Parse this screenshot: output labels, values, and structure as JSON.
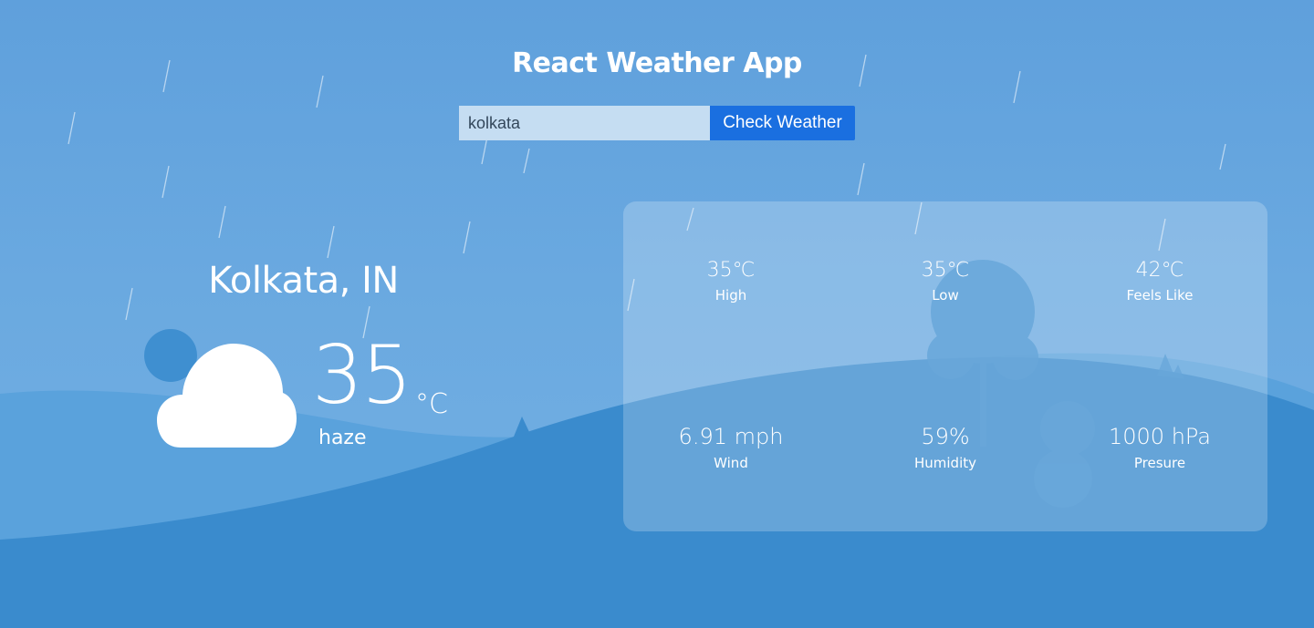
{
  "app": {
    "title": "React Weather App"
  },
  "search": {
    "value": "kolkata",
    "button_label": "Check Weather"
  },
  "current": {
    "city": "Kolkata, IN",
    "temp": "35",
    "unit": "°C",
    "description": "haze",
    "icon": "cloud-icon"
  },
  "details": {
    "high": {
      "value": "35℃",
      "label": "High"
    },
    "low": {
      "value": "35℃",
      "label": "Low"
    },
    "feels_like": {
      "value": "42℃",
      "label": "Feels Like"
    },
    "wind": {
      "value": "6.91 mph",
      "label": "Wind"
    },
    "humidity": {
      "value": "59%",
      "label": "Humidity"
    },
    "pressure": {
      "value": "1000 hPa",
      "label": "Presure"
    }
  },
  "colors": {
    "accent": "#1a6fe0",
    "hill": "#3a8bcd",
    "sky": "#5fa0dc"
  }
}
